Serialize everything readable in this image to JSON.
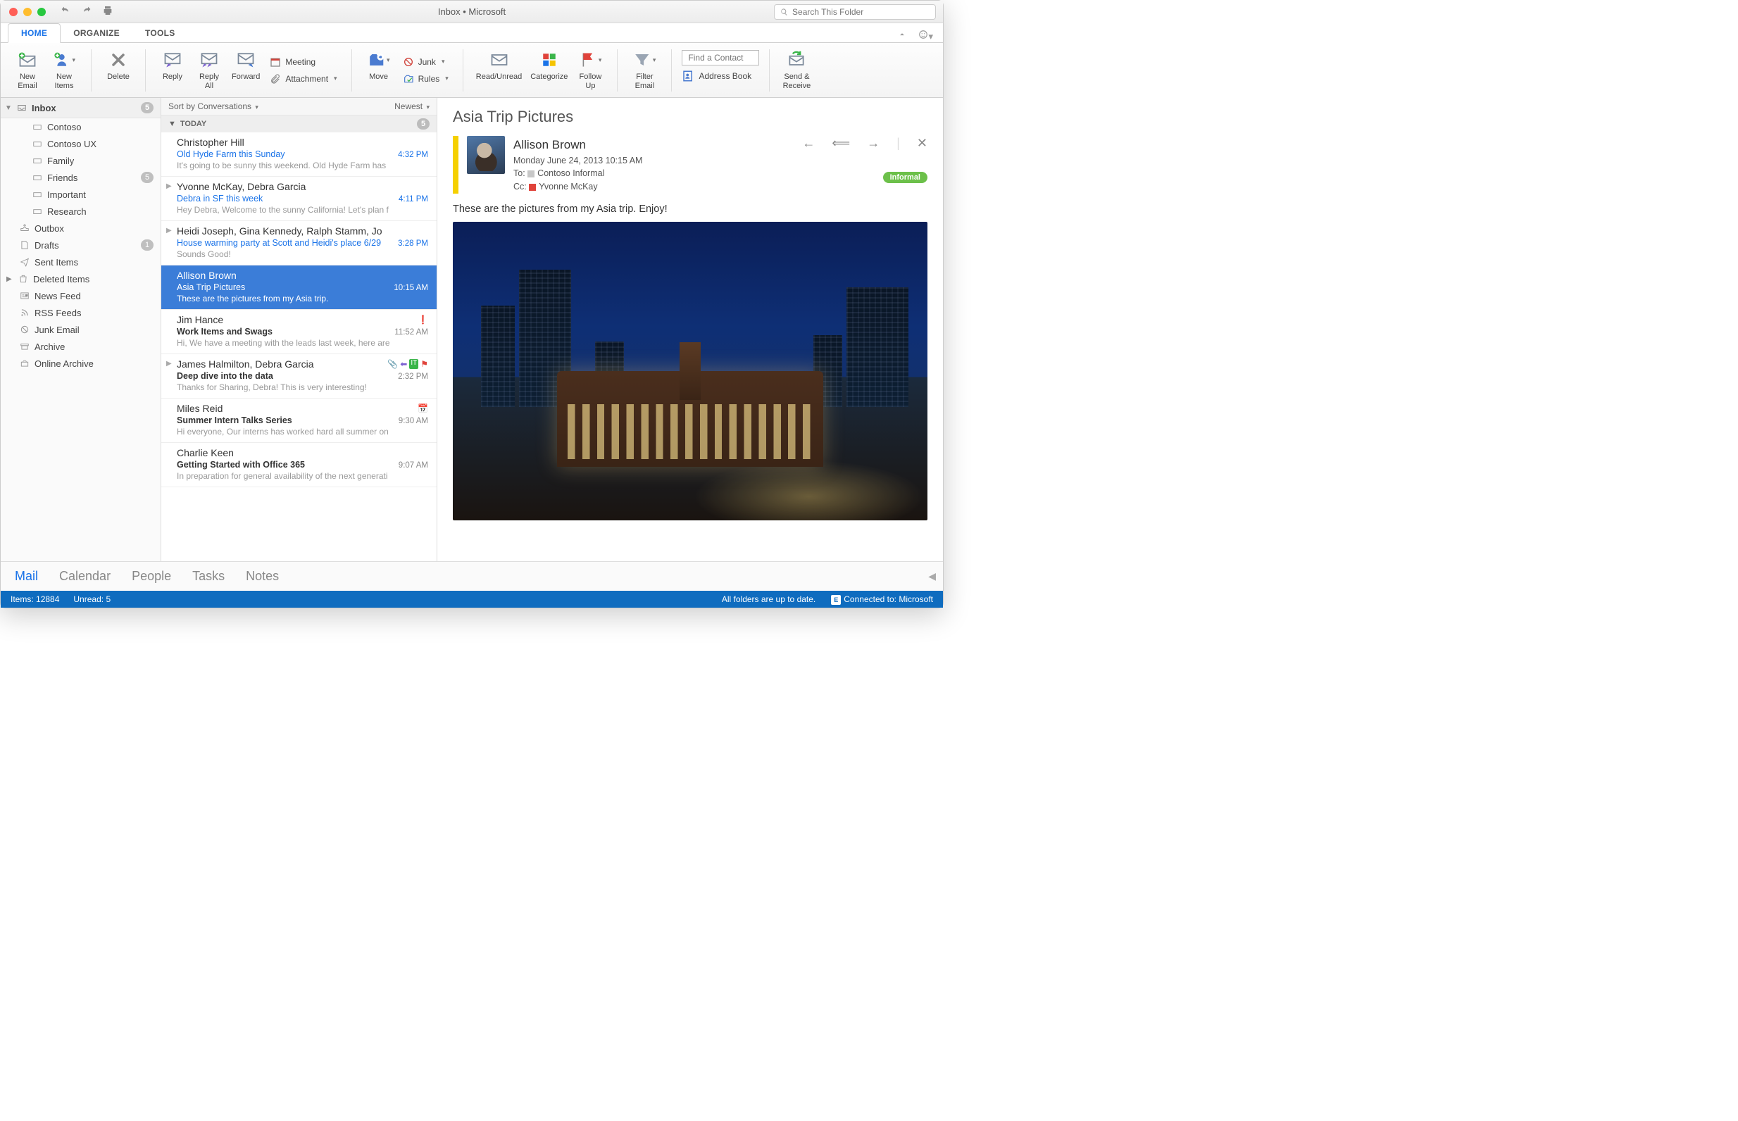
{
  "window": {
    "title": "Inbox • Microsoft"
  },
  "search": {
    "placeholder": "Search This Folder"
  },
  "tabs": {
    "home": "HOME",
    "organize": "ORGANIZE",
    "tools": "TOOLS"
  },
  "ribbon": {
    "new_email": "New\nEmail",
    "new_items": "New\nItems",
    "delete": "Delete",
    "reply": "Reply",
    "reply_all": "Reply\nAll",
    "forward": "Forward",
    "meeting": "Meeting",
    "attachment": "Attachment",
    "move": "Move",
    "junk": "Junk",
    "rules": "Rules",
    "read_unread": "Read/Unread",
    "categorize": "Categorize",
    "follow_up": "Follow\nUp",
    "filter_email": "Filter\nEmail",
    "find_contact_placeholder": "Find a Contact",
    "address_book": "Address Book",
    "send_receive": "Send &\nReceive"
  },
  "folders": {
    "inbox": {
      "label": "Inbox",
      "count": "5"
    },
    "items": [
      {
        "label": "Contoso"
      },
      {
        "label": "Contoso UX"
      },
      {
        "label": "Family"
      },
      {
        "label": "Friends",
        "count": "5"
      },
      {
        "label": "Important"
      },
      {
        "label": "Research"
      }
    ],
    "outbox": "Outbox",
    "drafts": {
      "label": "Drafts",
      "count": "1"
    },
    "sent": "Sent Items",
    "deleted": "Deleted Items",
    "news": "News Feed",
    "rss": "RSS Feeds",
    "junk": "Junk Email",
    "archive": "Archive",
    "online_archive": "Online Archive"
  },
  "msglist": {
    "sort": "Sort by Conversations",
    "order": "Newest",
    "day_header": "TODAY",
    "day_count": "5",
    "messages": [
      {
        "sender": "Christopher Hill",
        "subject": "Old Hyde Farm this Sunday",
        "time": "4:32 PM",
        "preview": "It's going to be sunny this weekend. Old Hyde Farm has",
        "unread": true
      },
      {
        "sender": "Yvonne McKay, Debra Garcia",
        "subject": "Debra in SF this week",
        "time": "4:11 PM",
        "preview": "Hey Debra, Welcome to the sunny California! Let's plan f",
        "unread": true,
        "thread": true
      },
      {
        "sender": "Heidi Joseph, Gina Kennedy, Ralph Stamm, Jo",
        "subject": "House warming party at Scott and Heidi's place 6/29",
        "time": "3:28 PM",
        "preview": "Sounds Good!",
        "unread": true,
        "thread": true
      },
      {
        "sender": "Allison Brown",
        "subject": "Asia Trip Pictures",
        "time": "10:15 AM",
        "preview": "These are the pictures from my Asia trip.",
        "selected": true
      },
      {
        "sender": "Jim Hance",
        "subject": "Work Items and Swags",
        "time": "11:52 AM",
        "preview": "Hi, We have a meeting with the leads last week, here are",
        "read": true,
        "priority": true
      },
      {
        "sender": "James Halmilton, Debra Garcia",
        "subject": "Deep dive into the data",
        "time": "2:32 PM",
        "preview": "Thanks for Sharing, Debra! This is very interesting!",
        "read": true,
        "thread": true,
        "icons": true
      },
      {
        "sender": "Miles Reid",
        "subject": "Summer Intern Talks Series",
        "time": "9:30 AM",
        "preview": "Hi everyone, Our interns has worked hard all summer on",
        "read": true,
        "cal": true
      },
      {
        "sender": "Charlie Keen",
        "subject": "Getting Started with Office 365",
        "time": "9:07 AM",
        "preview": "In preparation for general availability of the next generati",
        "read": true
      }
    ]
  },
  "reading": {
    "subject": "Asia Trip Pictures",
    "from": "Allison Brown",
    "date": "Monday June 24, 2013 10:15 AM",
    "to_label": "To:",
    "to": "Contoso Informal",
    "cc_label": "Cc:",
    "cc": "Yvonne McKay",
    "tag": "Informal",
    "body": "These are the pictures from my Asia trip.   Enjoy!"
  },
  "bottom": {
    "mail": "Mail",
    "calendar": "Calendar",
    "people": "People",
    "tasks": "Tasks",
    "notes": "Notes"
  },
  "status": {
    "items_label": "Items:",
    "items": "12884",
    "unread_label": "Unread:",
    "unread": "5",
    "uptodate": "All folders are up to date.",
    "connected": "Connected to: Microsoft"
  }
}
